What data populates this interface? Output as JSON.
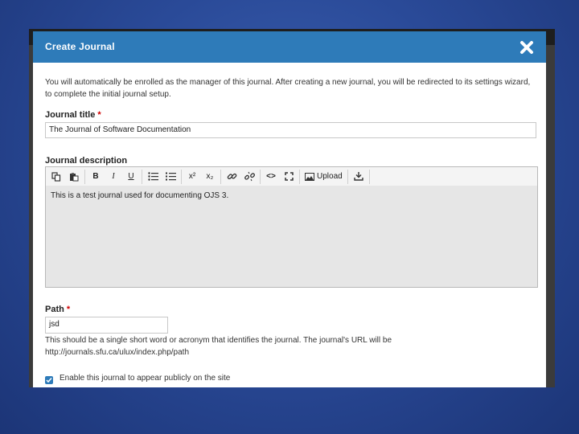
{
  "modal": {
    "title": "Create Journal",
    "intro": "You will automatically be enrolled as the manager of this journal. After creating a new journal, you will be redirected to its settings wizard, to complete the initial journal setup.",
    "required_marker": "*",
    "journal_title": {
      "label": "Journal title",
      "value": "The Journal of Software Documentation"
    },
    "journal_description": {
      "label": "Journal description",
      "toolbar": {
        "copy_icon": "copy-icon",
        "paste_icon": "paste-icon",
        "bold": "B",
        "italic": "I",
        "underline": "U",
        "bullet_list_icon": "bullet-list-icon",
        "numbered_list_icon": "numbered-list-icon",
        "superscript": "x²",
        "subscript": "x₂",
        "link_icon": "link-icon",
        "unlink_icon": "unlink-icon",
        "code": "<>",
        "fullscreen_icon": "fullscreen-icon",
        "upload_label": "Upload",
        "upload_icon": "image-upload-icon",
        "download_icon": "download-icon"
      },
      "content": "This is a test journal used for documenting OJS 3."
    },
    "path": {
      "label": "Path",
      "value": "jsd",
      "help": "This should be a single short word or acronym that identifies the journal. The journal's URL will be http://journals.sfu.ca/ulux/index.php/path"
    },
    "enable_public": {
      "label": "Enable this journal to appear publicly on the site",
      "checked": true
    }
  },
  "colors": {
    "header": "#2e7bb9",
    "required": "#d00000",
    "background": "#2a4a98"
  }
}
